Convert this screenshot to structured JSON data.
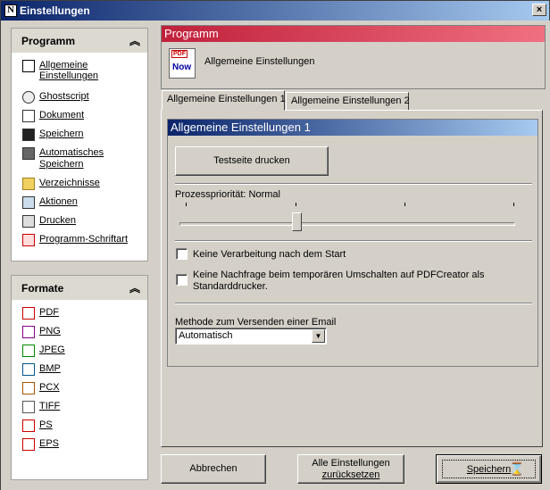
{
  "window": {
    "title": "Einstellungen",
    "close_glyph": "×"
  },
  "sidebar": {
    "programm": {
      "title": "Programm",
      "items": [
        {
          "label": "Allgemeine Einstellungen",
          "icon": "pdfcreator-icon"
        },
        {
          "label": "Ghostscript",
          "icon": "ghostscript-icon"
        },
        {
          "label": "Dokument",
          "icon": "document-icon"
        },
        {
          "label": "Speichern",
          "icon": "floppy-icon"
        },
        {
          "label": "Automatisches",
          "label2": "Speichern",
          "icon": "autosave-icon"
        },
        {
          "label": "Verzeichnisse",
          "icon": "folder-icon"
        },
        {
          "label": "Aktionen",
          "icon": "actions-icon"
        },
        {
          "label": "Drucken",
          "icon": "printer-icon"
        },
        {
          "label": "Programm-Schriftart",
          "icon": "font-icon"
        }
      ]
    },
    "formate": {
      "title": "Formate",
      "items": [
        {
          "label": "PDF",
          "icon": "pdf-icon"
        },
        {
          "label": "PNG",
          "icon": "png-icon"
        },
        {
          "label": "JPEG",
          "icon": "jpeg-icon"
        },
        {
          "label": "BMP",
          "icon": "bmp-icon"
        },
        {
          "label": "PCX",
          "icon": "pcx-icon"
        },
        {
          "label": "TIFF",
          "icon": "tiff-icon"
        },
        {
          "label": "PS",
          "icon": "ps-icon"
        },
        {
          "label": "EPS",
          "icon": "eps-icon"
        }
      ]
    }
  },
  "header": {
    "title": "Programm",
    "subtitle": "Allgemeine Einstellungen",
    "icon_text_top": "PDF",
    "icon_text_bottom": "Now"
  },
  "tabs": [
    {
      "label": "Allgemeine Einstellungen 1",
      "active": true
    },
    {
      "label": "Allgemeine Einstellungen 2",
      "active": false
    }
  ],
  "general1": {
    "title": "Allgemeine Einstellungen 1",
    "testpage_button": "Testseite drucken",
    "priority_label": "Prozesspriorität: Normal",
    "priority_level": 0.33,
    "checkbox1": {
      "label": "Keine Verarbeitung nach dem Start",
      "checked": false
    },
    "checkbox2": {
      "label": "Keine Nachfrage beim temporären Umschalten auf PDFCreator als",
      "label2": "Standarddrucker.",
      "checked": false
    },
    "email_method_label": "Methode zum Versenden einer Email",
    "email_method_value": "Automatisch"
  },
  "buttons": {
    "cancel": "Abbrechen",
    "reset_line1": "Alle Einstellungen",
    "reset_line2": "zurücksetzen",
    "save": "Speichern"
  }
}
